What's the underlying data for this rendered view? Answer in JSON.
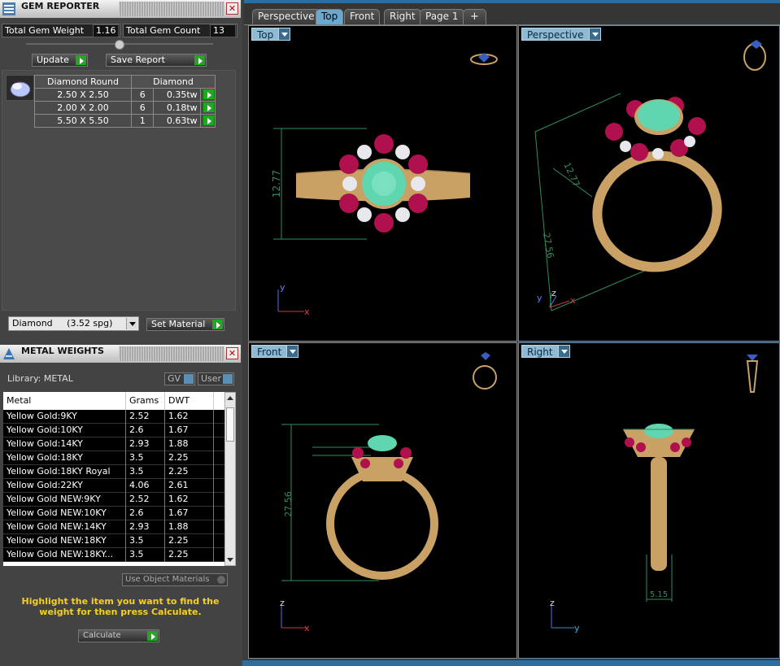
{
  "gem_reporter": {
    "title": "GEM REPORTER",
    "close": "✕",
    "total_weight_label": "Total Gem Weight",
    "total_weight_value": "1.16",
    "total_count_label": "Total Gem Count",
    "total_count_value": "13",
    "update_label": "Update",
    "save_report_label": "Save Report",
    "table": {
      "header_shape": "Diamond Round",
      "header_material": "Diamond",
      "rows": [
        {
          "size": "2.50 X 2.50",
          "count": "6",
          "weight": "0.35tw"
        },
        {
          "size": "2.00 X 2.00",
          "count": "6",
          "weight": "0.18tw"
        },
        {
          "size": "5.50 X 5.50",
          "count": "1",
          "weight": "0.63tw"
        }
      ]
    },
    "material_select": "Diamond     (3.52 spg)",
    "set_material_label": "Set Material"
  },
  "metal_weights": {
    "title": "METAL WEIGHTS",
    "close": "✕",
    "library_label": "Library: METAL",
    "gv_label": "GV",
    "user_label": "User",
    "columns": [
      "Metal",
      "Grams",
      "DWT"
    ],
    "rows": [
      {
        "metal": "Yellow Gold:9KY",
        "grams": "2.52",
        "dwt": "1.62"
      },
      {
        "metal": "Yellow Gold:10KY",
        "grams": "2.6",
        "dwt": "1.67"
      },
      {
        "metal": "Yellow Gold:14KY",
        "grams": "2.93",
        "dwt": "1.88"
      },
      {
        "metal": "Yellow Gold:18KY",
        "grams": "3.5",
        "dwt": "2.25"
      },
      {
        "metal": "Yellow Gold:18KY Royal",
        "grams": "3.5",
        "dwt": "2.25"
      },
      {
        "metal": "Yellow Gold:22KY",
        "grams": "4.06",
        "dwt": "2.61"
      },
      {
        "metal": "Yellow Gold NEW:9KY",
        "grams": "2.52",
        "dwt": "1.62"
      },
      {
        "metal": "Yellow Gold NEW:10KY",
        "grams": "2.6",
        "dwt": "1.67"
      },
      {
        "metal": "Yellow Gold NEW:14KY",
        "grams": "2.93",
        "dwt": "1.88"
      },
      {
        "metal": "Yellow Gold NEW:18KY",
        "grams": "3.5",
        "dwt": "2.25"
      },
      {
        "metal": "Yellow Gold NEW:18KY...",
        "grams": "3.5",
        "dwt": "2.25"
      }
    ],
    "use_object_materials_label": "Use Object Materials",
    "hint": "Highlight the item you want to find the weight for then press Calculate.",
    "calculate_label": "Calculate"
  },
  "tabs": [
    "Perspective",
    "Top",
    "Front",
    "Right",
    "Page 1"
  ],
  "add_tab": "+",
  "viewports": {
    "top": {
      "label": "Top",
      "dim": "12.77",
      "ax1": "y",
      "ax2": "x"
    },
    "perspective": {
      "label": "Perspective",
      "dim1": "12.77",
      "dim2": "27.56",
      "ax1": "y",
      "ax2": "z",
      "ax3": "x"
    },
    "front": {
      "label": "Front",
      "dim": "27.56",
      "ax1": "z",
      "ax2": "x"
    },
    "right": {
      "label": "Right",
      "dim": "5.15",
      "ax1": "z",
      "ax2": "y"
    }
  },
  "colors": {
    "gold": "#c9a165",
    "ruby": "#b0104e",
    "emerald": "#5fd6b0",
    "dim_line": "#2f8f5a",
    "hint": "#f5d21b",
    "tab_active": "#6aa8d0"
  }
}
